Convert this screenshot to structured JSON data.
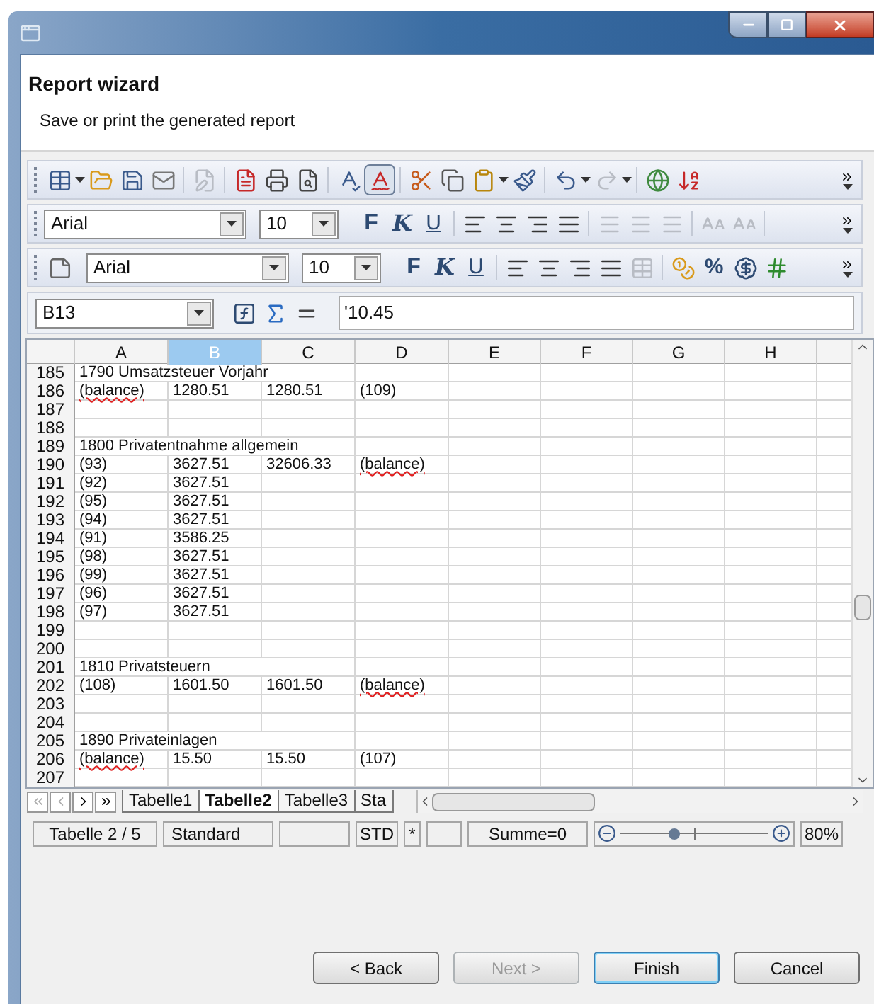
{
  "header": {
    "title": "Report wizard",
    "subtitle": "Save or print the generated report"
  },
  "standard_toolbar": {
    "edit_file": {
      "disabled": true
    },
    "auto_spellcheck": {
      "on": true
    },
    "redo": {
      "disabled": true
    }
  },
  "format_toolbars": [
    {
      "font": "Arial",
      "size": "10",
      "bold": "F",
      "italic": "K",
      "underline": "U",
      "extra_disabled": true
    },
    {
      "font": "Arial",
      "size": "10",
      "bold": "F",
      "italic": "K",
      "underline": "U",
      "percent": "%"
    }
  ],
  "formula_bar": {
    "cell": "B13",
    "value": "'10.45"
  },
  "sheet": {
    "columns": [
      {
        "label": "A",
        "selected": false
      },
      {
        "label": "B",
        "selected": true
      },
      {
        "label": "C",
        "selected": false
      },
      {
        "label": "D",
        "selected": false
      },
      {
        "label": "E",
        "selected": false
      },
      {
        "label": "F",
        "selected": false
      },
      {
        "label": "G",
        "selected": false
      },
      {
        "label": "H",
        "selected": false
      }
    ],
    "rows": [
      {
        "number": "185",
        "kind": "title",
        "title": "1790 Umsatzsteuer Vorjahr"
      },
      {
        "number": "186",
        "kind": "values",
        "cells": [
          {
            "text": "(balance)",
            "misspelled": true
          },
          "1280.51",
          "1280.51",
          "(109)"
        ]
      },
      {
        "number": "187",
        "kind": "empty"
      },
      {
        "number": "188",
        "kind": "empty"
      },
      {
        "number": "189",
        "kind": "title",
        "title": "1800 Privatentnahme allgemein"
      },
      {
        "number": "190",
        "kind": "values",
        "cells": [
          "(93)",
          "3627.51",
          "32606.33",
          {
            "text": "(balance)",
            "misspelled": true
          }
        ]
      },
      {
        "number": "191",
        "kind": "values",
        "cells": [
          "(92)",
          "3627.51"
        ]
      },
      {
        "number": "192",
        "kind": "values",
        "cells": [
          "(95)",
          "3627.51"
        ]
      },
      {
        "number": "193",
        "kind": "values",
        "cells": [
          "(94)",
          "3627.51"
        ]
      },
      {
        "number": "194",
        "kind": "values",
        "cells": [
          "(91)",
          "3586.25"
        ]
      },
      {
        "number": "195",
        "kind": "values",
        "cells": [
          "(98)",
          "3627.51"
        ]
      },
      {
        "number": "196",
        "kind": "values",
        "cells": [
          "(99)",
          "3627.51"
        ]
      },
      {
        "number": "197",
        "kind": "values",
        "cells": [
          "(96)",
          "3627.51"
        ]
      },
      {
        "number": "198",
        "kind": "values",
        "cells": [
          "(97)",
          "3627.51"
        ]
      },
      {
        "number": "199",
        "kind": "empty"
      },
      {
        "number": "200",
        "kind": "empty"
      },
      {
        "number": "201",
        "kind": "title",
        "title": "1810 Privatsteuern"
      },
      {
        "number": "202",
        "kind": "values",
        "cells": [
          "(108)",
          "1601.50",
          "1601.50",
          {
            "text": "(balance)",
            "misspelled": true
          }
        ]
      },
      {
        "number": "203",
        "kind": "empty"
      },
      {
        "number": "204",
        "kind": "empty"
      },
      {
        "number": "205",
        "kind": "title",
        "title": "1890 Privateinlagen"
      },
      {
        "number": "206",
        "kind": "values",
        "cells": [
          {
            "text": "(balance)",
            "misspelled": true
          },
          "15.50",
          "15.50",
          "(107)"
        ]
      },
      {
        "number": "207",
        "kind": "empty"
      }
    ],
    "tabs": [
      {
        "label": "Tabelle1",
        "selected": false
      },
      {
        "label": "Tabelle2",
        "selected": true
      },
      {
        "label": "Tabelle3",
        "selected": false
      },
      {
        "label": "Sta",
        "selected": false
      }
    ]
  },
  "status_bar": {
    "sheet": "Tabelle 2 / 5",
    "style": "Standard",
    "mode": "STD",
    "modified": "*",
    "sum": "Summe=0",
    "zoom": {
      "level": 0.37
    },
    "zoom_reading": "80%"
  },
  "buttons": [
    {
      "label": "< Back",
      "disabled": false,
      "default": false
    },
    {
      "label": "Next >",
      "disabled": true,
      "default": false
    },
    {
      "label": "Finish",
      "disabled": false,
      "default": true
    },
    {
      "label": "Cancel",
      "disabled": false,
      "default": false
    }
  ]
}
